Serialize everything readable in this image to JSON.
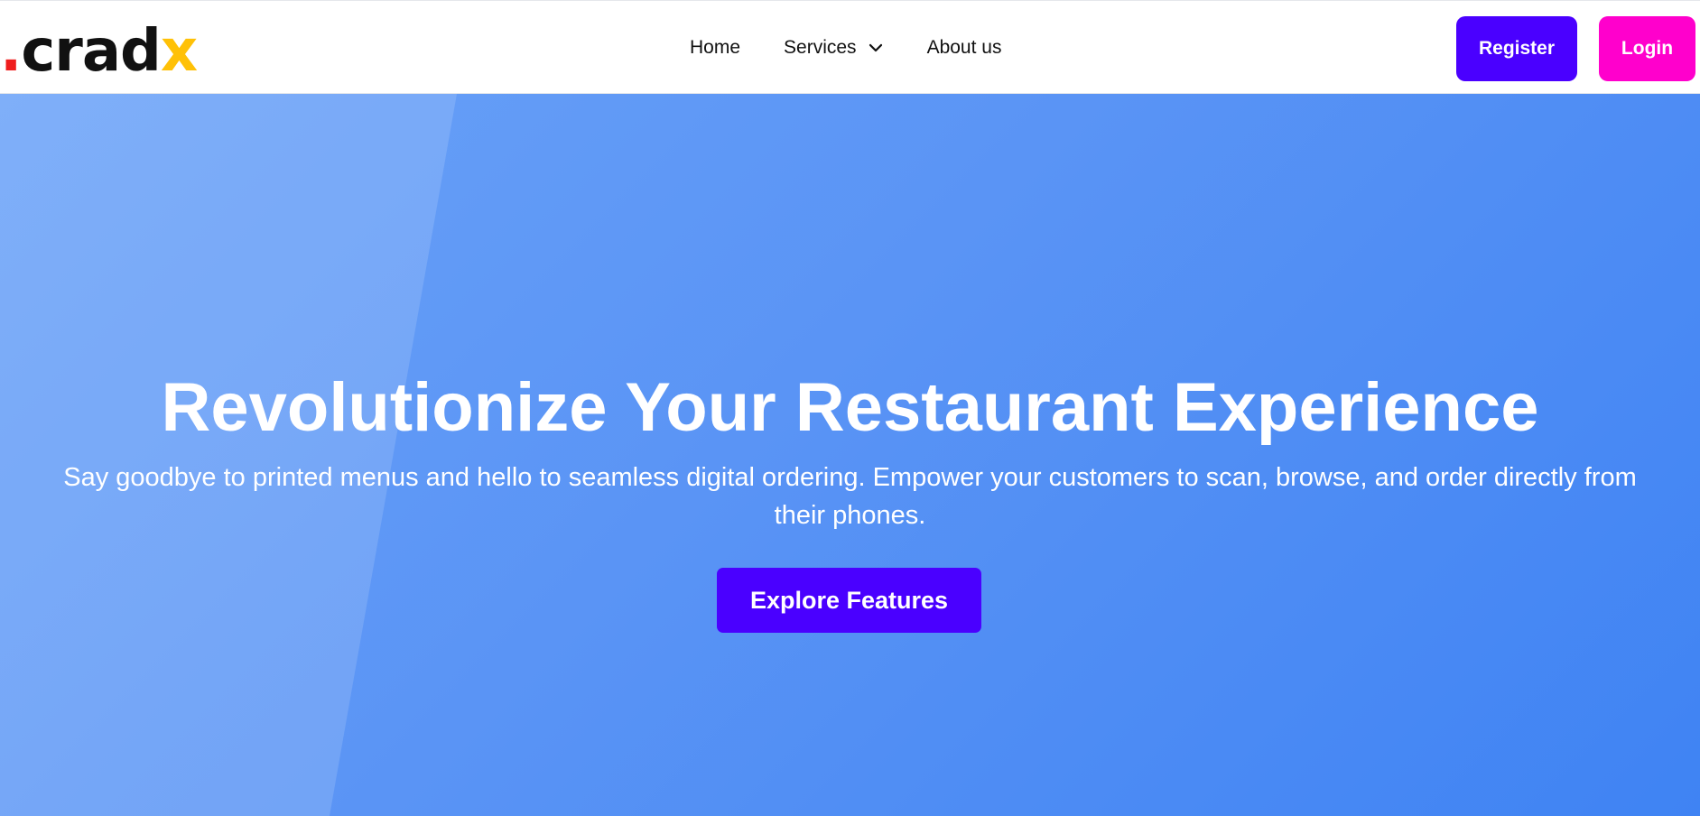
{
  "brand": {
    "dot": ".",
    "name": "crad",
    "accent_letter": "x"
  },
  "nav": {
    "home": "Home",
    "services": "Services",
    "about": "About us"
  },
  "auth": {
    "register_label": "Register",
    "login_label": "Login"
  },
  "hero": {
    "title": "Revolutionize Your Restaurant Experience",
    "subtitle": "Say goodbye to printed menus and hello to seamless digital ordering. Empower your customers to scan, browse, and order directly from their phones.",
    "cta_label": "Explore Features"
  },
  "colors": {
    "primary": "#4a00ff",
    "secondary": "#ff00cc",
    "hero_start": "#6aa2f8",
    "hero_end": "#3f83f3",
    "logo_dot": "#ef1d1d",
    "logo_accent": "#ffc107"
  },
  "icons": {
    "services_dropdown": "chevron-down-icon"
  }
}
